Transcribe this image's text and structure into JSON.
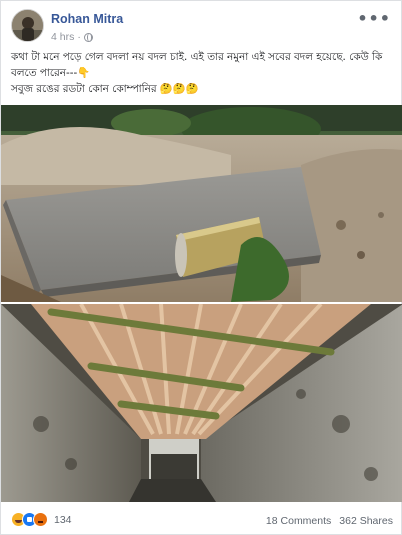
{
  "post": {
    "author": "Rohan Mitra",
    "time": "4 hrs",
    "privacy_icon": "globe-icon",
    "more_icon": "more-options-icon",
    "text_lines": [
      "কথা টা মনে পড়ে গেল বদলা নয় বদল চাই. এই তার নমুনা এই সবের বদল হয়েছে. কেউ কি বলতে পারেন---👇",
      "সবুজ রঙের রডটা কোন কোম্পানির 🤔🤔🤔"
    ],
    "reactions": {
      "icons": [
        "haha-reaction-icon",
        "like-reaction-icon",
        "angry-reaction-icon"
      ],
      "count": "134"
    },
    "comments": "18 Comments",
    "shares": "362 Shares"
  },
  "colors": {
    "author_link": "#385898",
    "muted": "#90949c",
    "haha": "#f7b125",
    "like": "#1877f2",
    "angry": "#e9710f"
  }
}
